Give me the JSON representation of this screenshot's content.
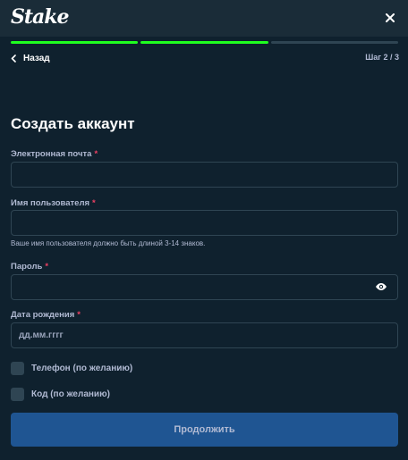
{
  "header": {
    "logo_text": "Stake",
    "close_icon": "close-icon"
  },
  "progress": {
    "total_steps": 3,
    "completed_steps": 2
  },
  "nav": {
    "back_label": "Назад",
    "back_icon": "chevron-left-icon",
    "step_text": "Шаг 2 / 3"
  },
  "form": {
    "title": "Создать аккаунт",
    "email": {
      "label": "Электронная почта",
      "required": "*",
      "value": "",
      "placeholder": ""
    },
    "username": {
      "label": "Имя пользователя",
      "required": "*",
      "value": "",
      "placeholder": "",
      "hint": "Ваше имя пользователя должно быть длиной 3-14 знаков."
    },
    "password": {
      "label": "Пароль",
      "required": "*",
      "value": "",
      "placeholder": "",
      "toggle_icon": "eye-icon"
    },
    "birthdate": {
      "label": "Дата рождения",
      "required": "*",
      "value": "",
      "placeholder": "дд.мм.гггг"
    },
    "phone_checkbox": {
      "label": "Телефон (по желанию)",
      "checked": false
    },
    "code_checkbox": {
      "label": "Код (по желанию)",
      "checked": false
    },
    "continue_label": "Продолжить"
  },
  "colors": {
    "background": "#0f212e",
    "header": "#1a2c38",
    "progress_done": "#1fff20",
    "progress_pending": "#2f4553",
    "required": "#ed4163",
    "button": "#1f5592",
    "muted_text": "#b1bad3"
  }
}
